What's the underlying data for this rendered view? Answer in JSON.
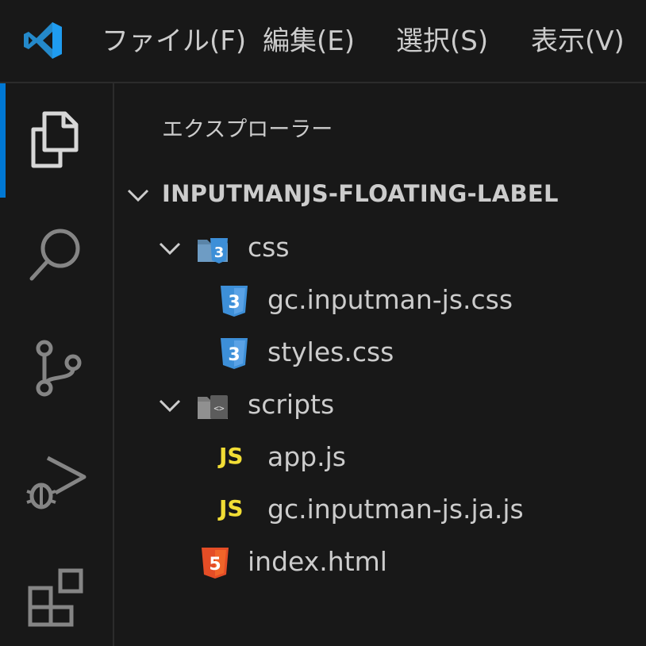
{
  "menu": {
    "items": [
      "ファイル(F)",
      "編集(E)",
      "選択(S)",
      "表示(V)"
    ]
  },
  "activity_bar": {
    "icons": [
      "files-icon",
      "search-icon",
      "source-control-icon",
      "run-debug-icon",
      "extensions-icon"
    ],
    "active_index": 0,
    "accent_color": "#0078d4"
  },
  "explorer": {
    "title": "エクスプローラー",
    "root": "INPUTMANJS-FLOATING-LABEL",
    "tree": [
      {
        "name": "css",
        "type": "folder",
        "icon": "css-folder-icon"
      },
      {
        "name": "gc.inputman-js.css",
        "type": "file",
        "icon": "css-file-icon"
      },
      {
        "name": "styles.css",
        "type": "file",
        "icon": "css-file-icon"
      },
      {
        "name": "scripts",
        "type": "folder",
        "icon": "scripts-folder-icon"
      },
      {
        "name": "app.js",
        "type": "file",
        "icon": "js-file-icon",
        "icon_text": "JS"
      },
      {
        "name": "gc.inputman-js.ja.js",
        "type": "file",
        "icon": "js-file-icon",
        "icon_text": "JS"
      },
      {
        "name": "index.html",
        "type": "file",
        "icon": "html-file-icon"
      }
    ]
  },
  "colors": {
    "background": "#181818",
    "css_blue": "#3d8fd8",
    "js_yellow": "#f1dd35",
    "html_orange": "#e44d26",
    "vscode_blue": "#2489ca"
  }
}
